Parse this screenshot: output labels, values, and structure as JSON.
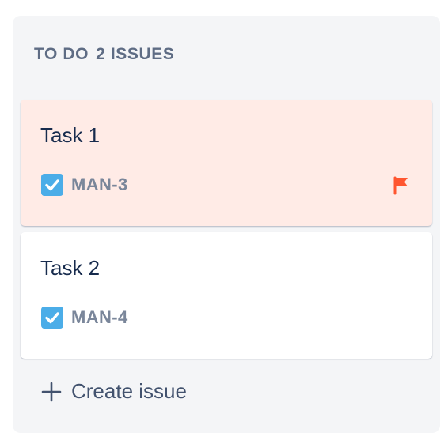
{
  "column": {
    "title": "TO DO",
    "count_label": "2 ISSUES"
  },
  "cards": [
    {
      "title": "Task 1",
      "key": "MAN-3",
      "type_icon": "checkbox-task-icon",
      "flagged": true,
      "flag_icon": "flag-icon"
    },
    {
      "title": "Task 2",
      "key": "MAN-4",
      "type_icon": "checkbox-task-icon",
      "flagged": false
    }
  ],
  "create": {
    "label": "Create issue",
    "icon": "plus-icon"
  },
  "colors": {
    "column_bg": "#f4f5f7",
    "flagged_card_bg": "#ffebe6",
    "card_bg": "#ffffff",
    "task_icon": "#4bade8",
    "flag": "#ff5630",
    "title_text": "#172b4d",
    "key_text": "#7a869a"
  }
}
